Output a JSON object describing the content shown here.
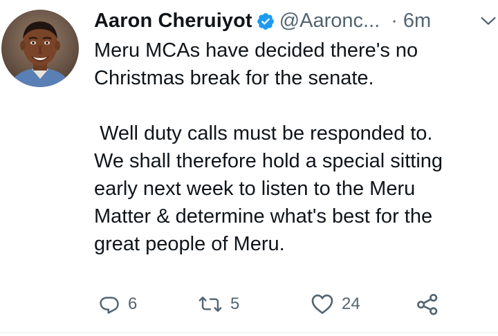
{
  "tweet": {
    "author": {
      "display_name": "Aaron Cheruiyot",
      "handle": "@Aaronc...",
      "verified_icon": "verified-badge-icon",
      "avatar_icon": "profile-avatar"
    },
    "separator": "·",
    "timestamp": "6m",
    "more_icon": "chevron-down-icon",
    "text": {
      "paragraph_1": "Meru MCAs have decided there's no\nChristmas break for the senate.",
      "paragraph_2": " Well duty calls must be responded to.\nWe shall therefore hold a special sitting\nearly next week to listen to the Meru\nMatter & determine what's best for the\ngreat people of Meru."
    },
    "actions": {
      "reply": {
        "icon": "reply-icon",
        "count": "6"
      },
      "retweet": {
        "icon": "retweet-icon",
        "count": "5"
      },
      "like": {
        "icon": "heart-icon",
        "count": "24"
      },
      "share": {
        "icon": "share-icon"
      }
    },
    "colors": {
      "verified": "#1d9bf0",
      "text": "#0f1419",
      "secondary": "#536471"
    }
  }
}
